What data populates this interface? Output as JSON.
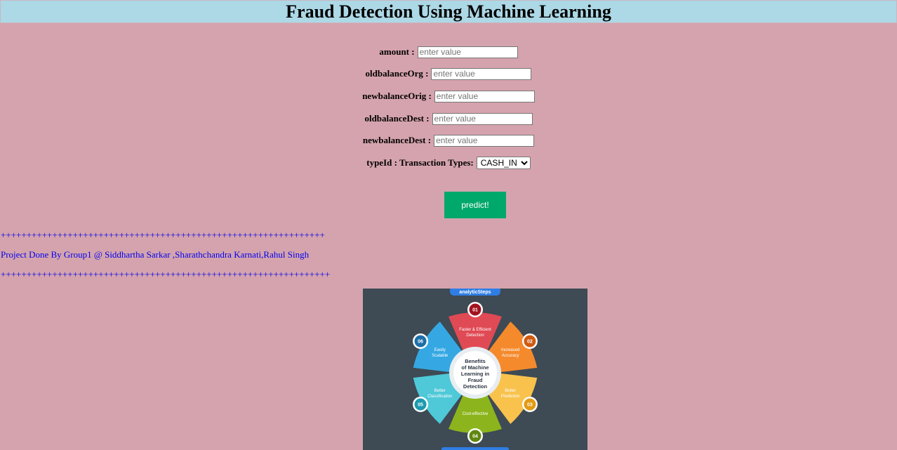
{
  "header": {
    "title": "Fraud Detection Using Machine Learning"
  },
  "form": {
    "fields": [
      {
        "label": "amount :",
        "placeholder": "enter value"
      },
      {
        "label": "oldbalanceOrg :",
        "placeholder": "enter value"
      },
      {
        "label": "newbalanceOrig :",
        "placeholder": "enter value"
      },
      {
        "label": "oldbalanceDest :",
        "placeholder": "enter value"
      },
      {
        "label": "newbalanceDest :",
        "placeholder": "enter value"
      }
    ],
    "type_label": "typeId : Transaction Types:",
    "type_selected": "CASH_IN",
    "predict_label": "predict!"
  },
  "footer": {
    "separator_top": "+++++++++++++++++++++++++++++++++++++++++++++++++++++++++++++++",
    "credits": "Project Done By Group1 @ Siddhartha Sarkar ,Sharathchandra Karnati,Rahul Singh",
    "separator_bottom": "++++++++++++++++++++++++++++++++++++++++++++++++++++++++++++++++"
  },
  "infographic": {
    "brand": "analyticSteps",
    "center": [
      "Benefits",
      "of Machine",
      "Learning in",
      "Fraud",
      "Detection"
    ],
    "petals": [
      {
        "num": "01",
        "lines": [
          "Faster & Efficient",
          "Detection"
        ],
        "color": "#e04a55",
        "num_color": "#a3121f"
      },
      {
        "num": "02",
        "lines": [
          "Increased",
          "Accuracy"
        ],
        "color": "#f58a2c",
        "num_color": "#d05a10"
      },
      {
        "num": "03",
        "lines": [
          "Better",
          "Prediction"
        ],
        "color": "#f8c24d",
        "num_color": "#e39a12"
      },
      {
        "num": "04",
        "lines": [
          "Cost-effective"
        ],
        "color": "#8cb51d",
        "num_color": "#5f8710"
      },
      {
        "num": "05",
        "lines": [
          "Better",
          "Classification"
        ],
        "color": "#4fc8d8",
        "num_color": "#1a9aae"
      },
      {
        "num": "06",
        "lines": [
          "Easily",
          "Scalable"
        ],
        "color": "#35a8e3",
        "num_color": "#1c6fa8"
      }
    ]
  }
}
